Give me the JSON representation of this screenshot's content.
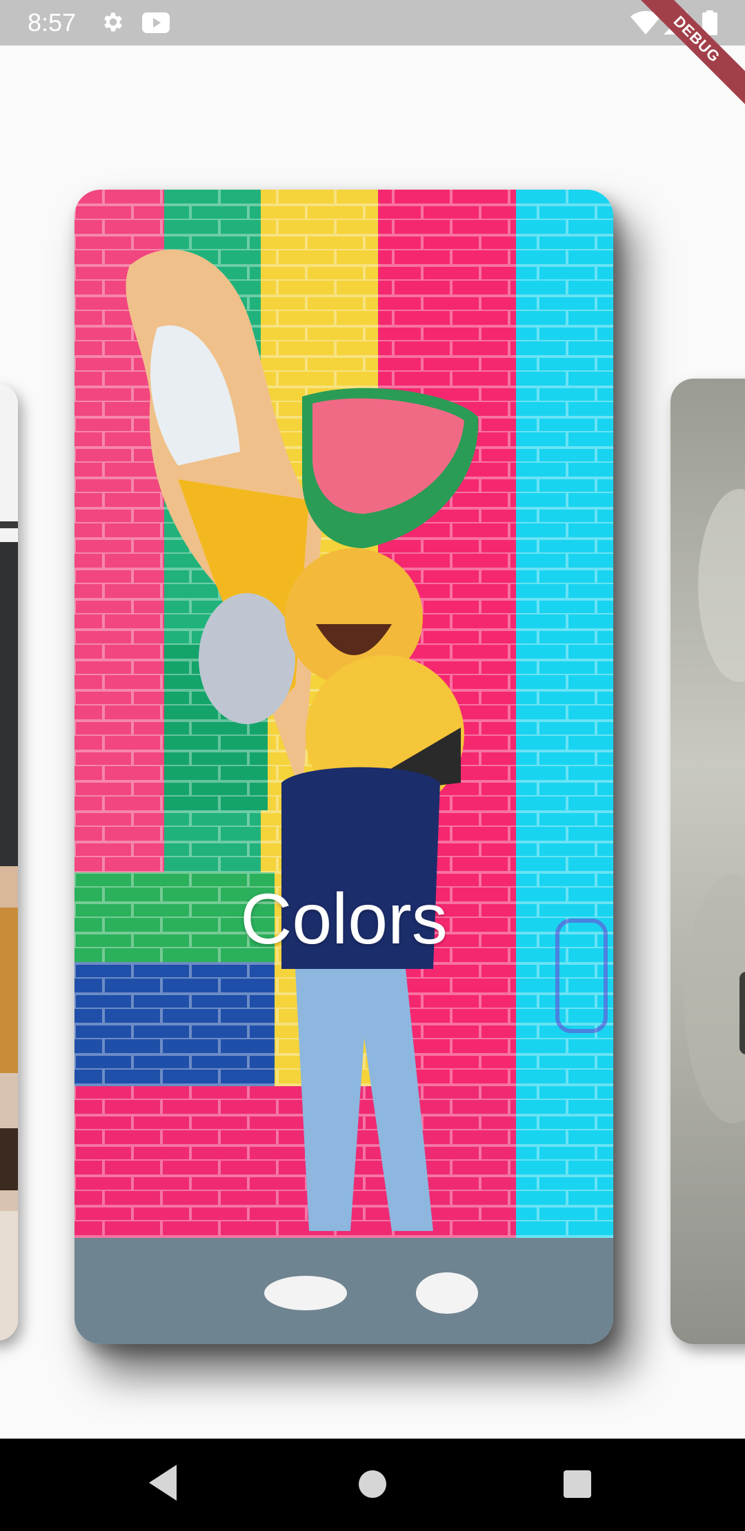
{
  "status_bar": {
    "time": "8:57",
    "icons": [
      "gear-icon",
      "youtube-icon",
      "wifi-icon",
      "signal-icon",
      "battery-icon"
    ]
  },
  "debug_banner": "DEBUG",
  "carousel": {
    "cards": [
      {
        "id": "left-partial",
        "title": ""
      },
      {
        "id": "main",
        "title": "Colors"
      },
      {
        "id": "right-partial",
        "title": ""
      }
    ]
  },
  "nav_bar": {
    "icons": [
      "back-icon",
      "home-icon",
      "recents-icon"
    ]
  },
  "colors": {
    "status_bar": "#c2c2c2",
    "page_background": "#fafafa",
    "debug_banner": "#a2404a",
    "nav_bar": "#000000"
  }
}
